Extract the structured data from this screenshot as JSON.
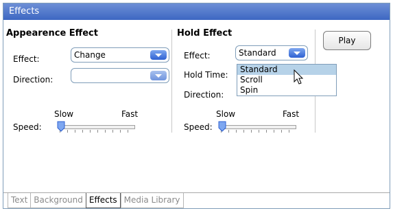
{
  "window": {
    "title": "Effects"
  },
  "appearance": {
    "title": "Appearence Effect",
    "effect_label": "Effect:",
    "effect_value": "Change",
    "direction_label": "Direction:",
    "direction_value": "",
    "slow_label": "Slow",
    "fast_label": "Fast",
    "speed_label": "Speed:",
    "speed_level": 0
  },
  "hold": {
    "title": "Hold Effect",
    "effect_label": "Effect:",
    "effect_value": "Standard",
    "hold_time_label": "Hold Time:",
    "direction_label": "Direction:",
    "slow_label": "Slow",
    "fast_label": "Fast",
    "speed_label": "Speed:",
    "speed_level": 0,
    "options": [
      "Standard",
      "Scroll",
      "Spin"
    ],
    "highlighted_option": "Standard"
  },
  "play_button": {
    "label": "Play"
  },
  "tabs": [
    {
      "label": "Text",
      "active": false
    },
    {
      "label": "Background",
      "active": false
    },
    {
      "label": "Effects",
      "active": true
    },
    {
      "label": "Media Library",
      "active": false
    }
  ],
  "colors": {
    "title_bar": "#4a74cc",
    "dropdown_button": "#3a6ad6",
    "highlight": "#b6d2e8"
  }
}
